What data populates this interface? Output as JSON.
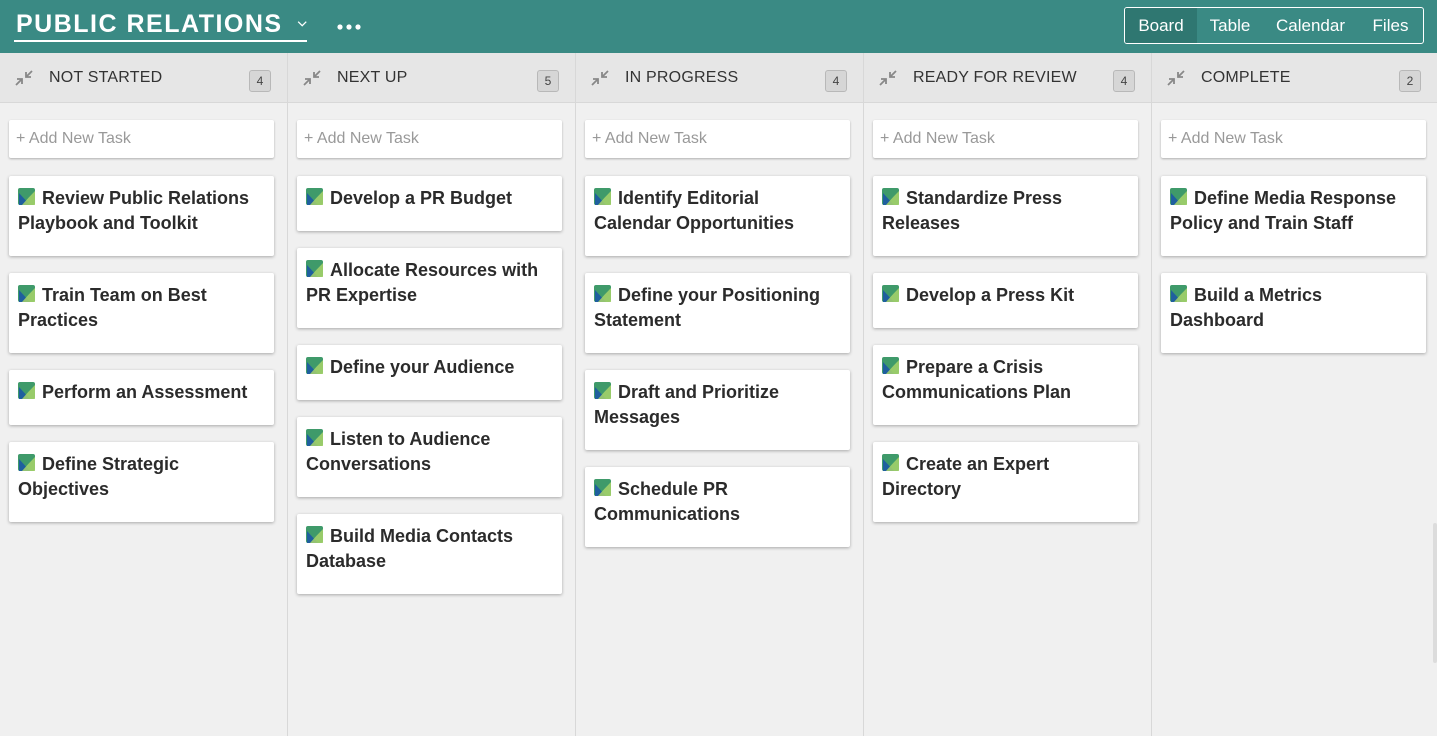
{
  "header": {
    "project_title": "PUBLIC RELATIONS",
    "views": [
      "Board",
      "Table",
      "Calendar",
      "Files"
    ],
    "active_view": "Board",
    "accent_color": "#3a8a84"
  },
  "board": {
    "add_task_placeholder": "+ Add New Task",
    "columns": [
      {
        "title": "NOT STARTED",
        "count": "4",
        "tasks": [
          "Review Public Relations Playbook and Toolkit",
          "Train Team on Best Practices",
          "Perform an Assessment",
          "Define Strategic Objectives"
        ]
      },
      {
        "title": "NEXT UP",
        "count": "5",
        "tasks": [
          "Develop a PR Budget",
          "Allocate Resources with PR Expertise",
          "Define your Audience",
          "Listen to Audience Conversations",
          "Build Media Contacts Database"
        ]
      },
      {
        "title": "IN PROGRESS",
        "count": "4",
        "tasks": [
          "Identify Editorial Calendar Opportunities",
          "Define your Positioning Statement",
          "Draft and Prioritize Messages",
          "Schedule PR Communications"
        ]
      },
      {
        "title": "READY FOR REVIEW",
        "count": "4",
        "tasks": [
          "Standardize Press Releases",
          "Develop a Press Kit",
          "Prepare a Crisis Communications Plan",
          "Create an Expert Directory"
        ]
      },
      {
        "title": "COMPLETE",
        "count": "2",
        "tasks": [
          "Define Media Response Policy and Train Staff",
          "Build a Metrics Dashboard"
        ]
      }
    ]
  }
}
